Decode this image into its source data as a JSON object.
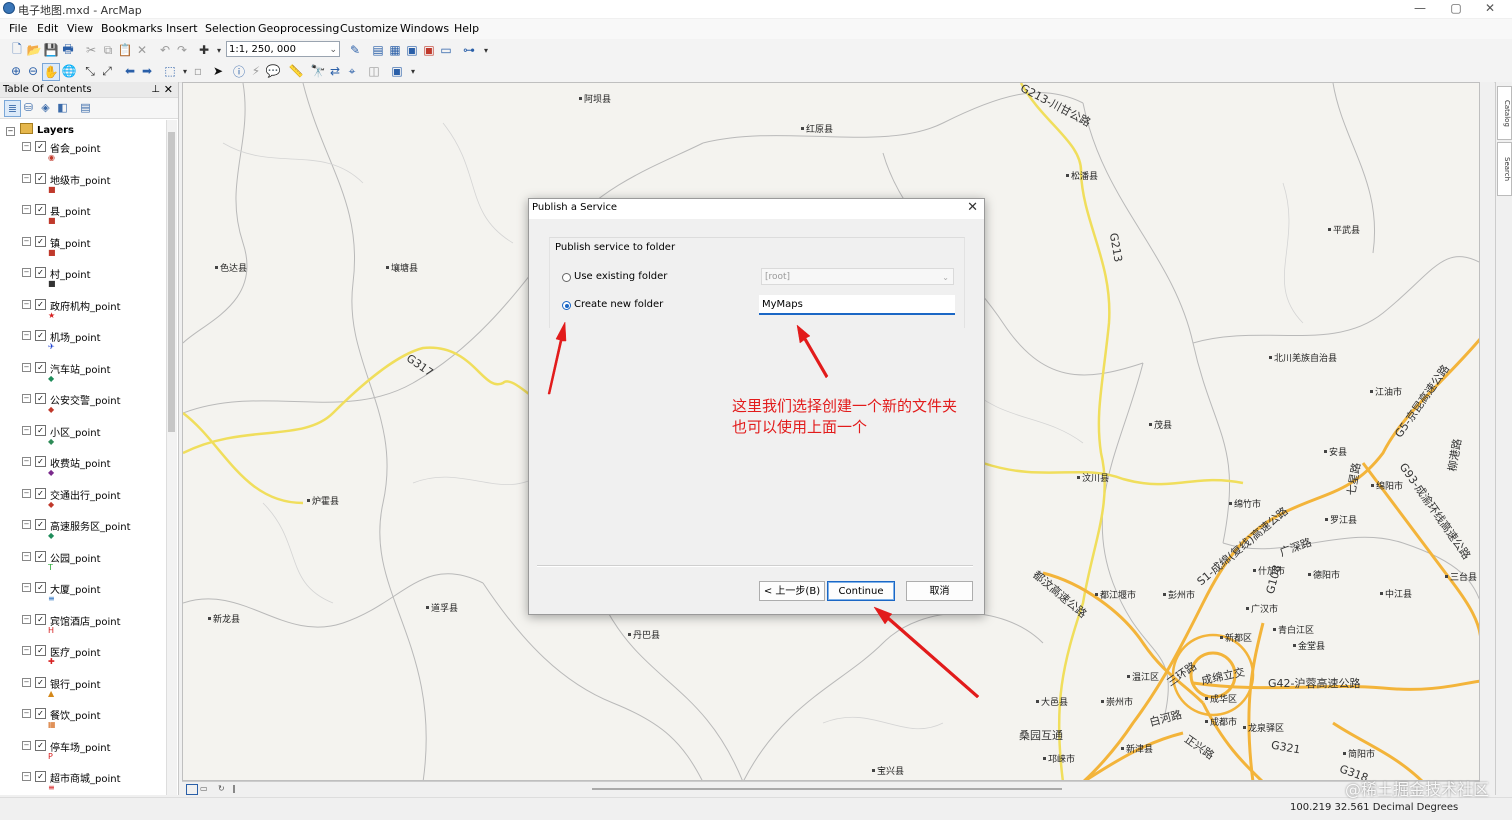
{
  "window": {
    "title": "电子地图.mxd - ArcMap",
    "min": "—",
    "max": "▢",
    "close": "✕"
  },
  "menu": [
    "File",
    "Edit",
    "View",
    "Bookmarks",
    "Insert",
    "Selection",
    "Geoprocessing",
    "Customize",
    "Windows",
    "Help"
  ],
  "toolbar": {
    "scale": "1:1, 250, 000"
  },
  "toc": {
    "title": "Table Of Contents",
    "root": "Layers",
    "layers": [
      {
        "name": "省会_point",
        "checked": true,
        "symbol_color": "#c0392b",
        "symbol": "◉"
      },
      {
        "name": "地级市_point",
        "checked": true,
        "symbol_color": "#c0392b",
        "symbol": "■"
      },
      {
        "name": "县_point",
        "checked": true,
        "symbol_color": "#c0392b",
        "symbol": "■"
      },
      {
        "name": "镇_point",
        "checked": true,
        "symbol_color": "#c0392b",
        "symbol": "■"
      },
      {
        "name": "村_point",
        "checked": true,
        "symbol_color": "#333333",
        "symbol": "■"
      },
      {
        "name": "政府机构_point",
        "checked": true,
        "symbol_color": "#d62020",
        "symbol": "★"
      },
      {
        "name": "机场_point",
        "checked": true,
        "symbol_color": "#1a3fd1",
        "symbol": "✈"
      },
      {
        "name": "汽车站_point",
        "checked": true,
        "symbol_color": "#1f8c5a",
        "symbol": "◆"
      },
      {
        "name": "公安交警_point",
        "checked": true,
        "symbol_color": "#c0392b",
        "symbol": "◆"
      },
      {
        "name": "小区_point",
        "checked": true,
        "symbol_color": "#2e8b57",
        "symbol": "◆"
      },
      {
        "name": "收费站_point",
        "checked": true,
        "symbol_color": "#7a2a8c",
        "symbol": "◆"
      },
      {
        "name": "交通出行_point",
        "checked": true,
        "symbol_color": "#c0392b",
        "symbol": "◆"
      },
      {
        "name": "高速服务区_point",
        "checked": true,
        "symbol_color": "#1f8c5a",
        "symbol": "◆"
      },
      {
        "name": "公园_point",
        "checked": true,
        "symbol_color": "#2eaa3c",
        "symbol": "T"
      },
      {
        "name": "大厦_point",
        "checked": true,
        "symbol_color": "#2a6fbf",
        "symbol": "≡"
      },
      {
        "name": "宾馆酒店_point",
        "checked": true,
        "symbol_color": "#d62020",
        "symbol": "H"
      },
      {
        "name": "医疗_point",
        "checked": true,
        "symbol_color": "#d62020",
        "symbol": "✚"
      },
      {
        "name": "银行_point",
        "checked": true,
        "symbol_color": "#d4881a",
        "symbol": "▲"
      },
      {
        "name": "餐饮_point",
        "checked": true,
        "symbol_color": "#d4681a",
        "symbol": "▦"
      },
      {
        "name": "停车场_point",
        "checked": true,
        "symbol_color": "#d62020",
        "symbol": "P"
      },
      {
        "name": "超市商城_point",
        "checked": true,
        "symbol_color": "#d62020",
        "symbol": "≡"
      }
    ]
  },
  "map": {
    "places": [
      "阿坝县",
      "红原县",
      "松潘县",
      "平武县",
      "色达县",
      "壤塘县",
      "北川羌族自治县",
      "江油市",
      "茂县",
      "安县",
      "汶川县",
      "绵竹市",
      "绵阳市",
      "罗江县",
      "炉霍县",
      "道孚县",
      "新龙县",
      "丹巴县",
      "什邡市",
      "德阳市",
      "都江堰市",
      "彭州市",
      "广汉市",
      "中江县",
      "三台县",
      "新都区",
      "青白江区",
      "金堂县",
      "温江区",
      "成华区",
      "崇州市",
      "大邑县",
      "成都市",
      "龙泉驿区",
      "新津县",
      "邛崃市",
      "宝兴县",
      "简阳市",
      "广汉市"
    ],
    "roads": [
      "G213-川甘公路",
      "G213",
      "G317",
      "G5-京昆高速公路",
      "G93-成渝环线高速公路",
      "S1-成绵(复线)高速公路",
      "G108",
      "广深路",
      "都汶高速公路",
      "三环路",
      "成绵立交",
      "G42-沪蓉高速公路",
      "白河路",
      "正兴路",
      "G321",
      "G318",
      "桑园互通",
      "七星路",
      "柳港路"
    ]
  },
  "dialog": {
    "title": "Publish a Service",
    "group_label": "Publish service to folder",
    "option_existing": "Use existing folder",
    "option_new": "Create new folder",
    "selected_option": "new",
    "existing_value": "[root]",
    "new_folder_value": "MyMaps",
    "back_button": "< 上一步(B)",
    "continue_button": "Continue",
    "cancel_button": "取消"
  },
  "annotation": {
    "line1": "这里我们选择创建一个新的文件夹",
    "line2": "也可以使用上面一个",
    "color": "#e21b1b"
  },
  "status": {
    "coords": "100.219  32.561 Decimal Degrees"
  },
  "watermark": "@稀土掘金技术社区"
}
